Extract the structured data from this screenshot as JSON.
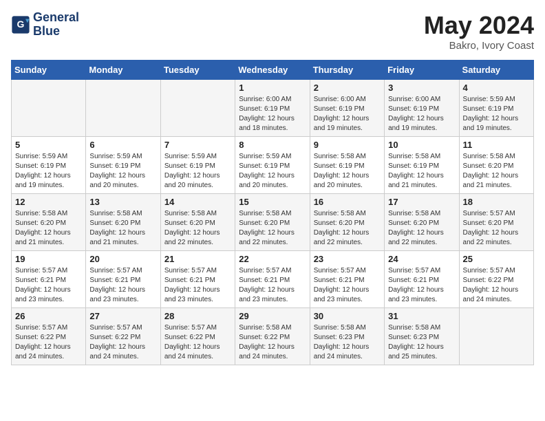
{
  "header": {
    "logo_line1": "General",
    "logo_line2": "Blue",
    "month": "May 2024",
    "location": "Bakro, Ivory Coast"
  },
  "weekdays": [
    "Sunday",
    "Monday",
    "Tuesday",
    "Wednesday",
    "Thursday",
    "Friday",
    "Saturday"
  ],
  "weeks": [
    [
      {
        "day": "",
        "info": ""
      },
      {
        "day": "",
        "info": ""
      },
      {
        "day": "",
        "info": ""
      },
      {
        "day": "1",
        "info": "Sunrise: 6:00 AM\nSunset: 6:19 PM\nDaylight: 12 hours\nand 18 minutes."
      },
      {
        "day": "2",
        "info": "Sunrise: 6:00 AM\nSunset: 6:19 PM\nDaylight: 12 hours\nand 19 minutes."
      },
      {
        "day": "3",
        "info": "Sunrise: 6:00 AM\nSunset: 6:19 PM\nDaylight: 12 hours\nand 19 minutes."
      },
      {
        "day": "4",
        "info": "Sunrise: 5:59 AM\nSunset: 6:19 PM\nDaylight: 12 hours\nand 19 minutes."
      }
    ],
    [
      {
        "day": "5",
        "info": "Sunrise: 5:59 AM\nSunset: 6:19 PM\nDaylight: 12 hours\nand 19 minutes."
      },
      {
        "day": "6",
        "info": "Sunrise: 5:59 AM\nSunset: 6:19 PM\nDaylight: 12 hours\nand 20 minutes."
      },
      {
        "day": "7",
        "info": "Sunrise: 5:59 AM\nSunset: 6:19 PM\nDaylight: 12 hours\nand 20 minutes."
      },
      {
        "day": "8",
        "info": "Sunrise: 5:59 AM\nSunset: 6:19 PM\nDaylight: 12 hours\nand 20 minutes."
      },
      {
        "day": "9",
        "info": "Sunrise: 5:58 AM\nSunset: 6:19 PM\nDaylight: 12 hours\nand 20 minutes."
      },
      {
        "day": "10",
        "info": "Sunrise: 5:58 AM\nSunset: 6:19 PM\nDaylight: 12 hours\nand 21 minutes."
      },
      {
        "day": "11",
        "info": "Sunrise: 5:58 AM\nSunset: 6:20 PM\nDaylight: 12 hours\nand 21 minutes."
      }
    ],
    [
      {
        "day": "12",
        "info": "Sunrise: 5:58 AM\nSunset: 6:20 PM\nDaylight: 12 hours\nand 21 minutes."
      },
      {
        "day": "13",
        "info": "Sunrise: 5:58 AM\nSunset: 6:20 PM\nDaylight: 12 hours\nand 21 minutes."
      },
      {
        "day": "14",
        "info": "Sunrise: 5:58 AM\nSunset: 6:20 PM\nDaylight: 12 hours\nand 22 minutes."
      },
      {
        "day": "15",
        "info": "Sunrise: 5:58 AM\nSunset: 6:20 PM\nDaylight: 12 hours\nand 22 minutes."
      },
      {
        "day": "16",
        "info": "Sunrise: 5:58 AM\nSunset: 6:20 PM\nDaylight: 12 hours\nand 22 minutes."
      },
      {
        "day": "17",
        "info": "Sunrise: 5:58 AM\nSunset: 6:20 PM\nDaylight: 12 hours\nand 22 minutes."
      },
      {
        "day": "18",
        "info": "Sunrise: 5:57 AM\nSunset: 6:20 PM\nDaylight: 12 hours\nand 22 minutes."
      }
    ],
    [
      {
        "day": "19",
        "info": "Sunrise: 5:57 AM\nSunset: 6:21 PM\nDaylight: 12 hours\nand 23 minutes."
      },
      {
        "day": "20",
        "info": "Sunrise: 5:57 AM\nSunset: 6:21 PM\nDaylight: 12 hours\nand 23 minutes."
      },
      {
        "day": "21",
        "info": "Sunrise: 5:57 AM\nSunset: 6:21 PM\nDaylight: 12 hours\nand 23 minutes."
      },
      {
        "day": "22",
        "info": "Sunrise: 5:57 AM\nSunset: 6:21 PM\nDaylight: 12 hours\nand 23 minutes."
      },
      {
        "day": "23",
        "info": "Sunrise: 5:57 AM\nSunset: 6:21 PM\nDaylight: 12 hours\nand 23 minutes."
      },
      {
        "day": "24",
        "info": "Sunrise: 5:57 AM\nSunset: 6:21 PM\nDaylight: 12 hours\nand 23 minutes."
      },
      {
        "day": "25",
        "info": "Sunrise: 5:57 AM\nSunset: 6:22 PM\nDaylight: 12 hours\nand 24 minutes."
      }
    ],
    [
      {
        "day": "26",
        "info": "Sunrise: 5:57 AM\nSunset: 6:22 PM\nDaylight: 12 hours\nand 24 minutes."
      },
      {
        "day": "27",
        "info": "Sunrise: 5:57 AM\nSunset: 6:22 PM\nDaylight: 12 hours\nand 24 minutes."
      },
      {
        "day": "28",
        "info": "Sunrise: 5:57 AM\nSunset: 6:22 PM\nDaylight: 12 hours\nand 24 minutes."
      },
      {
        "day": "29",
        "info": "Sunrise: 5:58 AM\nSunset: 6:22 PM\nDaylight: 12 hours\nand 24 minutes."
      },
      {
        "day": "30",
        "info": "Sunrise: 5:58 AM\nSunset: 6:23 PM\nDaylight: 12 hours\nand 24 minutes."
      },
      {
        "day": "31",
        "info": "Sunrise: 5:58 AM\nSunset: 6:23 PM\nDaylight: 12 hours\nand 25 minutes."
      },
      {
        "day": "",
        "info": ""
      }
    ]
  ]
}
